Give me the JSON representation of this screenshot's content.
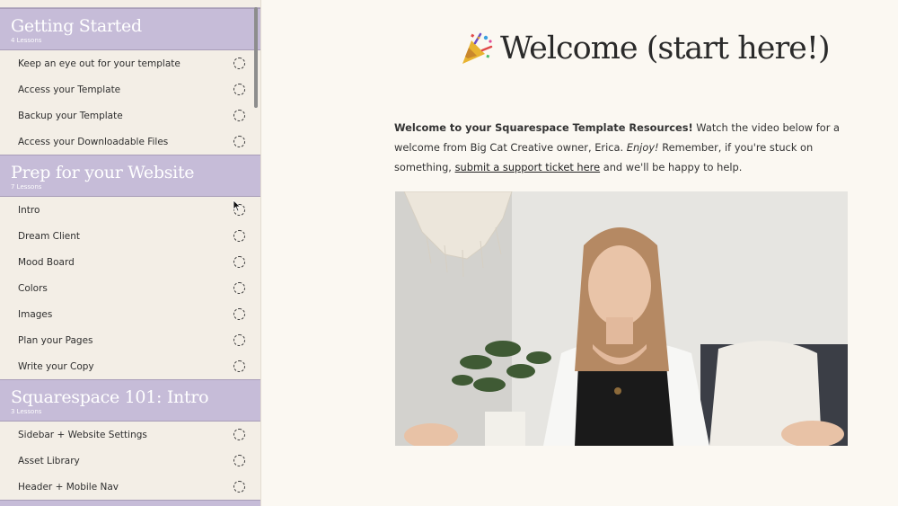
{
  "sidebar": {
    "sections": [
      {
        "title": "Getting Started",
        "count": "4 Lessons",
        "lessons": [
          "Keep an eye out for your template",
          "Access your Template",
          "Backup your Template",
          "Access your Downloadable Files"
        ]
      },
      {
        "title": "Prep for your Website",
        "count": "7 Lessons",
        "lessons": [
          "Intro",
          "Dream Client",
          "Mood Board",
          "Colors",
          "Images",
          "Plan your Pages",
          "Write your Copy"
        ]
      },
      {
        "title": "Squarespace 101: Intro",
        "count": "3 Lessons",
        "lessons": [
          "Sidebar + Website Settings",
          "Asset Library",
          "Header + Mobile Nav"
        ]
      }
    ]
  },
  "main": {
    "title_icon": "party-popper-icon",
    "title": "Welcome (start here!)",
    "intro": {
      "bold": "Welcome to your Squarespace Template Resources!",
      "text1": " Watch the video below for a welcome from Big Cat Creative owner, Erica. ",
      "italic": "Enjoy!",
      "text2": " Remember, if you're stuck on something, ",
      "link": "submit a support ticket here",
      "text3": " and we'll be happy to help."
    }
  },
  "colors": {
    "section_header": "#c6bcd8",
    "sidebar_bg": "#f3eee6",
    "page_bg": "#fbf8f2"
  }
}
